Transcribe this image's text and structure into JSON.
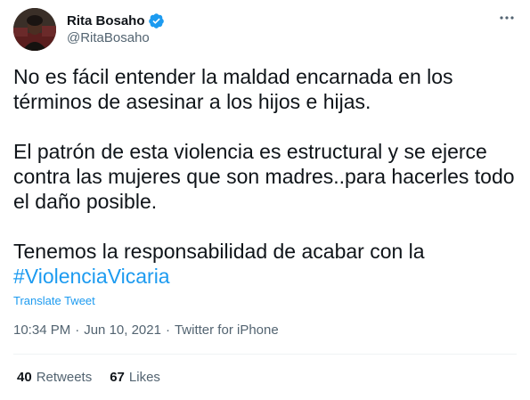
{
  "author": {
    "display_name": "Rita Bosaho",
    "handle": "@RitaBosaho",
    "verified": true
  },
  "tweet": {
    "paragraphs": [
      "No es fácil entender la maldad encarnada en los\ntérminos de asesinar a los hijos e hijas.",
      "El patrón de esta violencia es estructural y se ejerce\ncontra las mujeres que son madres..para hacerles todo\nel daño posible.",
      "Tenemos la responsabilidad de acabar con la"
    ],
    "hashtag": "#ViolenciaVicaria",
    "translate_label": "Translate Tweet"
  },
  "meta": {
    "time": "10:34 PM",
    "separator": "·",
    "date": "Jun 10, 2021",
    "source": "Twitter for iPhone"
  },
  "stats": {
    "retweets_count": "40",
    "retweets_label": "Retweets",
    "likes_count": "67",
    "likes_label": "Likes"
  },
  "colors": {
    "accent": "#1d9bf0",
    "text": "#0f1419",
    "secondary": "#536471",
    "divider": "#eff3f4"
  },
  "icons": {
    "verified": "verified-badge-icon",
    "more": "more-options-icon"
  }
}
